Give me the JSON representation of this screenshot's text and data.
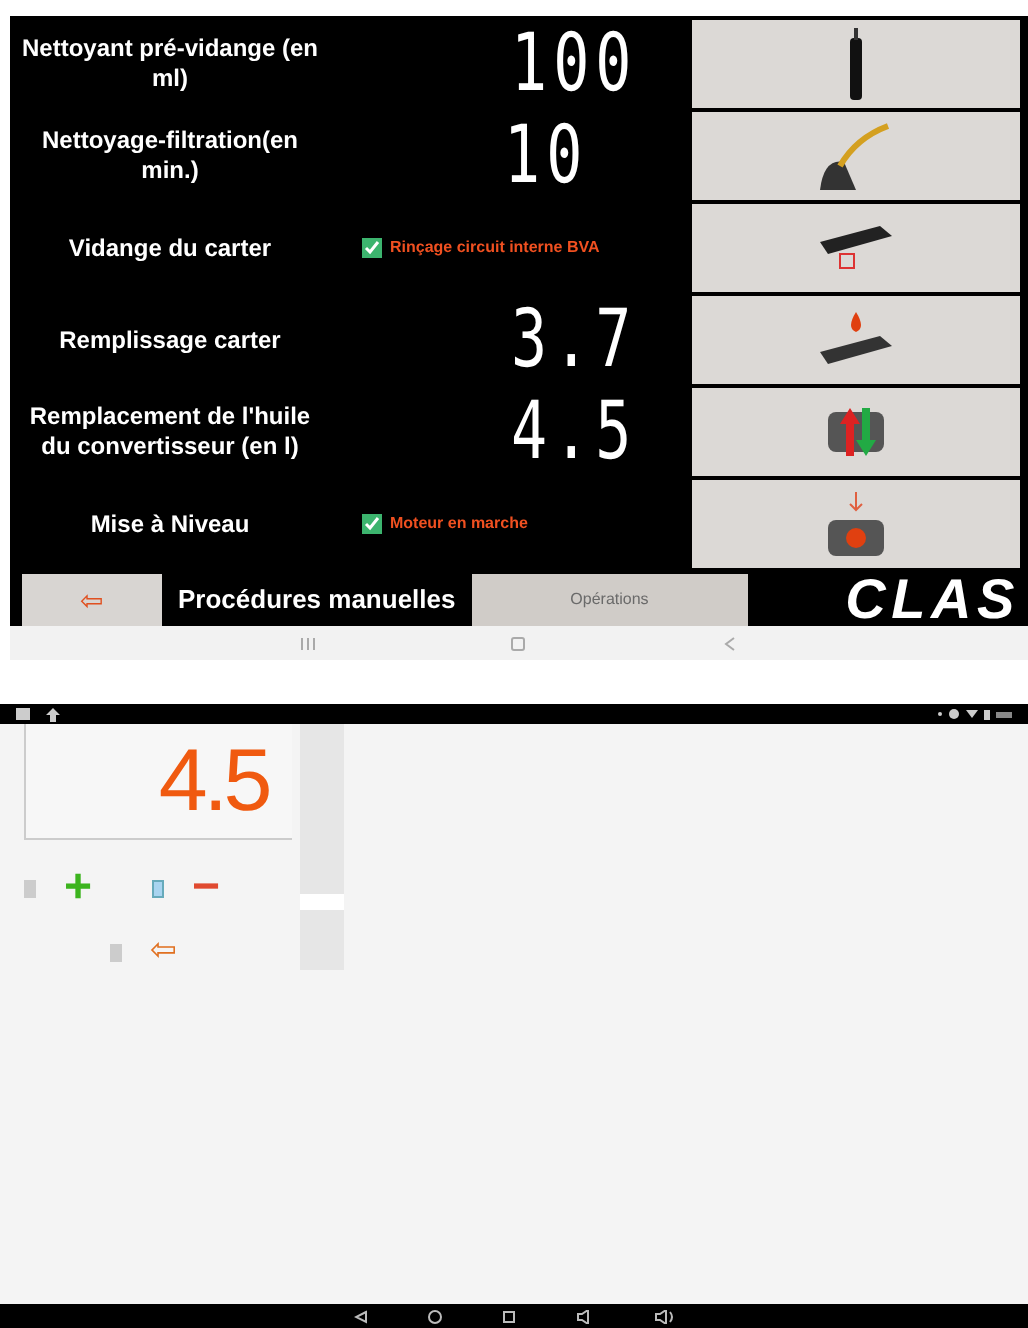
{
  "top_screen": {
    "rows": [
      {
        "label": "Nettoyant pré-vidange (en ml)",
        "value": "100"
      },
      {
        "label": "Nettoyage-filtration(en min.)",
        "value": "10"
      },
      {
        "label": "Vidange du carter",
        "option": {
          "label": "Rinçage circuit interne BVA",
          "checked": true
        }
      },
      {
        "label": "Remplissage carter",
        "value": "3.7"
      },
      {
        "label": "Remplacement de l'huile du convertisseur (en l)",
        "value": "4.5"
      },
      {
        "label": "Mise à Niveau",
        "option": {
          "label": "Moteur en marche",
          "checked": true
        }
      }
    ],
    "back_button": "⇦",
    "section_title": "Procédures manuelles",
    "operations_button": "Opérations",
    "logo": "CLAS"
  },
  "bottom_screen": {
    "display": "4.5",
    "plus": "+",
    "minus": "−",
    "back": "⇦"
  }
}
